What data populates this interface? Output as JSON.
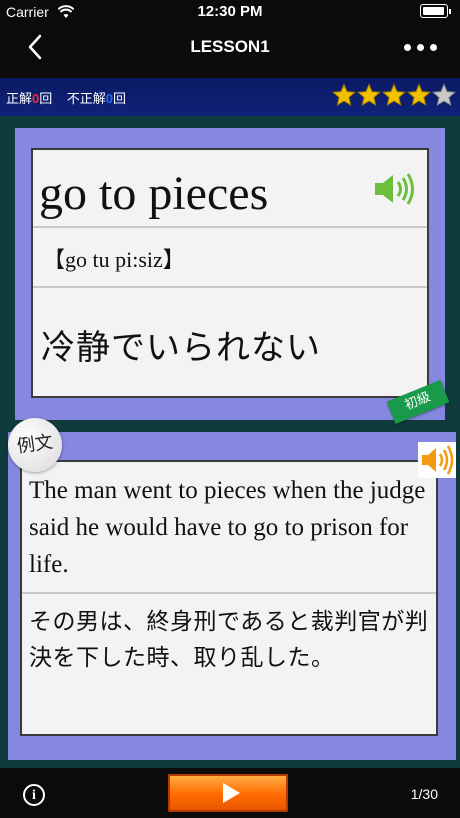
{
  "status_bar": {
    "carrier": "Carrier",
    "time": "12:30 PM"
  },
  "nav": {
    "title": "LESSON1"
  },
  "score": {
    "correct_label": "正解",
    "correct_count": "0",
    "correct_unit": "回",
    "incorrect_label": "不正解",
    "incorrect_count": "0",
    "incorrect_unit": "回",
    "stars_filled": 4,
    "stars_total": 5
  },
  "word_card": {
    "word": "go to pieces",
    "pronunciation": "【go tu pi:siz】",
    "meaning": "冷静でいられない",
    "level": "初級"
  },
  "example": {
    "tag": "例文",
    "english": "The man went to pieces when the judge said he would have to go to prison for life.",
    "japanese": "その男は、終身刑であると裁判官が判決を下した時、取り乱した。"
  },
  "bottom": {
    "info": "i",
    "page": "1/30"
  },
  "colors": {
    "card_frame": "#8587e0",
    "background": "#0f3b3d",
    "badge": "#199a4a",
    "play_button": "#ff6a00",
    "star": "#f2c200"
  }
}
